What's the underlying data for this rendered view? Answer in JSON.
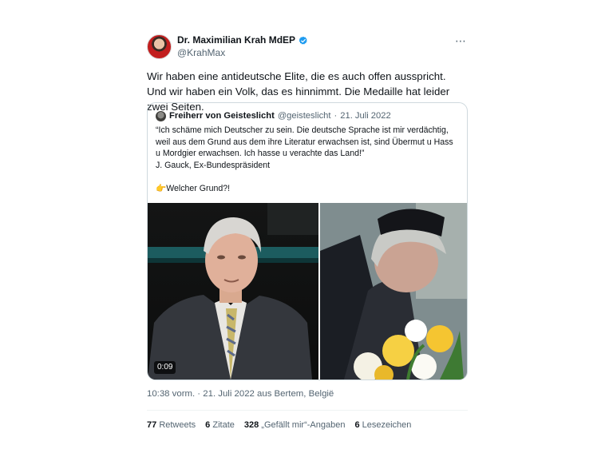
{
  "author": {
    "name": "Dr. Maximilian Krah MdEP",
    "handle": "@KrahMax",
    "verified_color": "#1d9bf0"
  },
  "more_icon": "⋯",
  "tweet_text": "Wir haben eine antideutsche Elite, die es auch offen ausspricht. Und wir haben ein Volk, das es hinnimmt. Die Medaille hat leider zwei Seiten.",
  "quote": {
    "name": "Freiherr von Geisteslicht",
    "handle": "@geisteslicht",
    "separator": "·",
    "date": "21. Juli 2022",
    "lines": [
      "“Ich schäme mich Deutscher zu sein. Die deutsche Sprache ist mir verdächtig,",
      "weil aus dem Grund aus dem ihre Literatur erwachsen ist, sind Übermut u Hass",
      "u Mordgier erwachsen. Ich hasse u verachte das Land!”",
      "J. Gauck, Ex-Bundespräsident",
      "👉Welcher Grund?!"
    ],
    "video_time": "0:09"
  },
  "meta": "10:38 vorm. · 21. Juli 2022 aus Bertem, België",
  "stats": {
    "retweets_count": "77",
    "retweets_label": "Retweets",
    "quotes_count": "6",
    "quotes_label": "Zitate",
    "likes_count": "328",
    "likes_label": "„Gefällt mir“-Angaben",
    "bookmarks_count": "6",
    "bookmarks_label": "Lesezeichen"
  }
}
